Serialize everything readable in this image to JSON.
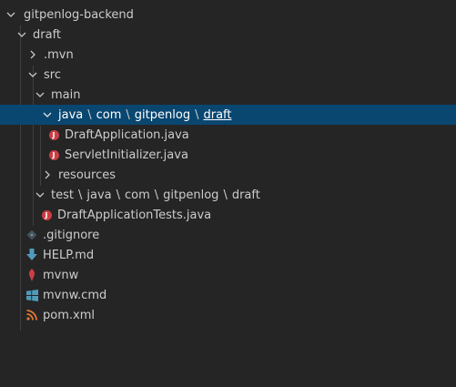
{
  "explorer": {
    "root": "gitpenlog-backend",
    "draft": "draft",
    "mvn": ".mvn",
    "src": "src",
    "main": "main",
    "main_path": [
      "java",
      "com",
      "gitpenlog",
      "draft"
    ],
    "path_separator": "\\",
    "draft_application": "DraftApplication.java",
    "servlet_initializer": "ServletInitializer.java",
    "resources": "resources",
    "test_path": [
      "test",
      "java",
      "com",
      "gitpenlog",
      "draft"
    ],
    "draft_application_tests": "DraftApplicationTests.java",
    "gitignore": ".gitignore",
    "help": "HELP.md",
    "mvnw": "mvnw",
    "mvnw_cmd": "mvnw.cmd",
    "pom": "pom.xml",
    "java_badge": "J"
  },
  "colors": {
    "background": "#252526",
    "selection": "#094771",
    "java_icon": "#cc3e44",
    "markdown_icon": "#519aba",
    "windows_icon": "#519aba",
    "xml_icon": "#e37933",
    "git_icon": "#41535b",
    "mvnw_icon": "#cc3e44"
  },
  "icons": {
    "expanded": "chevron-down-icon",
    "collapsed": "chevron-right-icon",
    "java": "java-file-icon",
    "git": "git-icon",
    "markdown": "markdown-icon",
    "mvnw": "maven-wrapper-icon",
    "cmd": "windows-icon",
    "xml": "rss-xml-icon"
  }
}
